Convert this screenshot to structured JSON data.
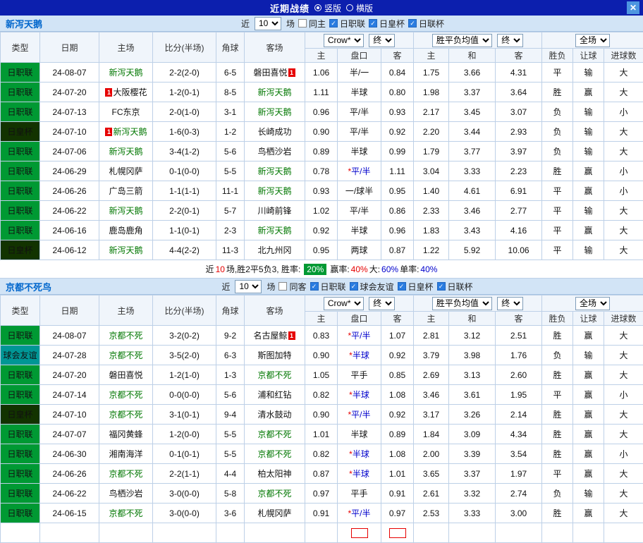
{
  "colors": {
    "titlebar_bg": "#0c1fae",
    "league_green": "#009933",
    "emperor_cup_dark": "#123300",
    "friendly_teal": "#009695",
    "focus_team_green": "#007700",
    "score_red": "#e60000",
    "odds_blue": "#0000cc",
    "win_red": "#e60000",
    "lose_green": "#008800",
    "draw_blue": "#0000cc",
    "rate_badge_green": "#009933"
  },
  "titlebar": {
    "title": "近期战绩",
    "vertical_label": "竖版",
    "horizontal_label": "横版",
    "close_label": "✕"
  },
  "table_header": {
    "type": "类型",
    "date": "日期",
    "home": "主场",
    "score": "比分(半场)",
    "corner": "角球",
    "away": "客场",
    "odds_source": "Crow*",
    "final_a": "终",
    "h_home": "主",
    "h_handicap": "盘口",
    "h_away": "客",
    "avg_label": "胜平负均值",
    "final_b": "终",
    "a_home": "主",
    "a_draw": "和",
    "a_away": "客",
    "wdl": "胜负",
    "handicap_res": "让球",
    "goals": "进球数",
    "scope": "全场"
  },
  "sections": [
    {
      "team": "新泻天鹅",
      "filter": {
        "near": "近",
        "count": "10",
        "games": "场",
        "same": "同主",
        "leagues": [
          "日职联",
          "日皇杯",
          "日联杯"
        ]
      },
      "rows": [
        {
          "league": "日职联",
          "style": "green",
          "date": "24-08-07",
          "home": "新泻天鹅",
          "home_focus": true,
          "score": "2-2(2-0)",
          "corner": "6-5",
          "away": "磐田喜悦",
          "away_badge_post": "1",
          "ch": "1.06",
          "hd": "半/一",
          "ca": "0.84",
          "ah": "1.75",
          "ad": "3.66",
          "aa": "4.31",
          "wdl": "平",
          "hres": "输",
          "goal": "大"
        },
        {
          "league": "日职联",
          "style": "green",
          "date": "24-07-20",
          "home": "大阪樱花",
          "home_badge_pre": "1",
          "score": "1-2(0-1)",
          "corner": "8-5",
          "away": "新泻天鹅",
          "away_focus": true,
          "ch": "1.11",
          "hd": "半球",
          "ca": "0.80",
          "ah": "1.98",
          "ad": "3.37",
          "aa": "3.64",
          "wdl": "胜",
          "hres": "赢",
          "goal": "大"
        },
        {
          "league": "日职联",
          "style": "green",
          "date": "24-07-13",
          "home": "FC东京",
          "score": "2-0(1-0)",
          "corner": "3-1",
          "away": "新泻天鹅",
          "away_focus": true,
          "ch": "0.96",
          "hd": "平/半",
          "ca": "0.93",
          "ah": "2.17",
          "ad": "3.45",
          "aa": "3.07",
          "wdl": "负",
          "hres": "输",
          "goal": "小"
        },
        {
          "league": "日皇杯",
          "style": "dark",
          "date": "24-07-10",
          "home": "新泻天鹅",
          "home_focus": true,
          "home_badge_pre": "1",
          "score": "1-6(0-3)",
          "corner": "1-2",
          "away": "长崎成功",
          "ch": "0.90",
          "hd": "平/半",
          "ca": "0.92",
          "ah": "2.20",
          "ad": "3.44",
          "aa": "2.93",
          "wdl": "负",
          "hres": "输",
          "goal": "大"
        },
        {
          "league": "日职联",
          "style": "green",
          "date": "24-07-06",
          "home": "新泻天鹅",
          "home_focus": true,
          "score": "3-4(1-2)",
          "corner": "5-6",
          "away": "鸟栖沙岩",
          "ch": "0.89",
          "hd": "半球",
          "ca": "0.99",
          "ah": "1.79",
          "ad": "3.77",
          "aa": "3.97",
          "wdl": "负",
          "hres": "输",
          "goal": "大"
        },
        {
          "league": "日职联",
          "style": "green",
          "date": "24-06-29",
          "home": "札幌冈萨",
          "score": "0-1(0-0)",
          "corner": "5-5",
          "away": "新泻天鹅",
          "away_focus": true,
          "ch": "0.78",
          "hd": "*平/半",
          "ca": "1.11",
          "ah": "3.04",
          "ad": "3.33",
          "aa": "2.23",
          "wdl": "胜",
          "hres": "赢",
          "goal": "小"
        },
        {
          "league": "日职联",
          "style": "green",
          "date": "24-06-26",
          "home": "广岛三箭",
          "score": "1-1(1-1)",
          "corner": "11-1",
          "away": "新泻天鹅",
          "away_focus": true,
          "ch": "0.93",
          "hd": "一/球半",
          "ca": "0.95",
          "ah": "1.40",
          "ad": "4.61",
          "aa": "6.91",
          "wdl": "平",
          "hres": "赢",
          "goal": "小"
        },
        {
          "league": "日职联",
          "style": "green",
          "date": "24-06-22",
          "home": "新泻天鹅",
          "home_focus": true,
          "score": "2-2(0-1)",
          "corner": "5-7",
          "away": "川崎前锋",
          "ch": "1.02",
          "hd": "平/半",
          "ca": "0.86",
          "ah": "2.33",
          "ad": "3.46",
          "aa": "2.77",
          "wdl": "平",
          "hres": "输",
          "goal": "大"
        },
        {
          "league": "日职联",
          "style": "green",
          "date": "24-06-16",
          "home": "鹿岛鹿角",
          "score": "1-1(0-1)",
          "corner": "2-3",
          "away": "新泻天鹅",
          "away_focus": true,
          "ch": "0.92",
          "hd": "半球",
          "ca": "0.96",
          "ah": "1.83",
          "ad": "3.43",
          "aa": "4.16",
          "wdl": "平",
          "hres": "赢",
          "goal": "大"
        },
        {
          "league": "日皇杯",
          "style": "dark",
          "date": "24-06-12",
          "home": "新泻天鹅",
          "home_focus": true,
          "score": "4-4(2-2)",
          "corner": "11-3",
          "away": "北九州冈",
          "ch": "0.95",
          "hd": "两球",
          "ca": "0.87",
          "ah": "1.22",
          "ad": "5.92",
          "aa": "10.06",
          "wdl": "平",
          "hres": "输",
          "goal": "大"
        }
      ],
      "summary": [
        {
          "t": "近",
          "c": "k"
        },
        {
          "t": "10",
          "c": "r"
        },
        {
          "t": "场,胜2平5负3, 胜率: ",
          "c": "k"
        },
        {
          "t": "20%",
          "c": "badge"
        },
        {
          "t": " 赢率:",
          "c": "k"
        },
        {
          "t": "40%",
          "c": "r"
        },
        {
          "t": " 大:",
          "c": "k"
        },
        {
          "t": "60%",
          "c": "b"
        },
        {
          "t": " 单率:",
          "c": "k"
        },
        {
          "t": "40%",
          "c": "b"
        }
      ]
    },
    {
      "team": "京都不死鸟",
      "filter": {
        "near": "近",
        "count": "10",
        "games": "场",
        "same": "同客",
        "leagues": [
          "日职联",
          "球会友谊",
          "日皇杯",
          "日联杯"
        ]
      },
      "rows": [
        {
          "league": "日职联",
          "style": "green",
          "date": "24-08-07",
          "home": "京都不死",
          "home_focus": true,
          "score": "3-2(0-2)",
          "corner": "9-2",
          "away": "名古屋鲸",
          "away_badge_post": "1",
          "ch": "0.83",
          "hd": "*平/半",
          "ca": "1.07",
          "ah": "2.81",
          "ad": "3.12",
          "aa": "2.51",
          "wdl": "胜",
          "hres": "赢",
          "goal": "大"
        },
        {
          "league": "球会友谊",
          "style": "teal",
          "date": "24-07-28",
          "home": "京都不死",
          "home_focus": true,
          "score": "3-5(2-0)",
          "corner": "6-3",
          "away": "斯图加特",
          "ch": "0.90",
          "hd": "*半球",
          "ca": "0.92",
          "ah": "3.79",
          "ad": "3.98",
          "aa": "1.76",
          "wdl": "负",
          "hres": "输",
          "goal": "大"
        },
        {
          "league": "日职联",
          "style": "green",
          "date": "24-07-20",
          "home": "磐田喜悦",
          "score": "1-2(1-0)",
          "corner": "1-3",
          "away": "京都不死",
          "away_focus": true,
          "ch": "1.05",
          "hd": "平手",
          "ca": "0.85",
          "ah": "2.69",
          "ad": "3.13",
          "aa": "2.60",
          "wdl": "胜",
          "hres": "赢",
          "goal": "大"
        },
        {
          "league": "日职联",
          "style": "green",
          "date": "24-07-14",
          "home": "京都不死",
          "home_focus": true,
          "score": "0-0(0-0)",
          "corner": "5-6",
          "away": "浦和红钻",
          "ch": "0.82",
          "hd": "*半球",
          "ca": "1.08",
          "ah": "3.46",
          "ad": "3.61",
          "aa": "1.95",
          "wdl": "平",
          "hres": "赢",
          "goal": "小"
        },
        {
          "league": "日皇杯",
          "style": "dark",
          "date": "24-07-10",
          "home": "京都不死",
          "home_focus": true,
          "score": "3-1(0-1)",
          "corner": "9-4",
          "away": "清水鼓动",
          "ch": "0.90",
          "hd": "*平/半",
          "ca": "0.92",
          "ah": "3.17",
          "ad": "3.26",
          "aa": "2.14",
          "wdl": "胜",
          "hres": "赢",
          "goal": "大"
        },
        {
          "league": "日职联",
          "style": "green",
          "date": "24-07-07",
          "home": "福冈黄蜂",
          "score": "1-2(0-0)",
          "corner": "5-5",
          "away": "京都不死",
          "away_focus": true,
          "ch": "1.01",
          "hd": "半球",
          "ca": "0.89",
          "ah": "1.84",
          "ad": "3.09",
          "aa": "4.34",
          "wdl": "胜",
          "hres": "赢",
          "goal": "大"
        },
        {
          "league": "日职联",
          "style": "green",
          "date": "24-06-30",
          "home": "湘南海洋",
          "score": "0-1(0-1)",
          "corner": "5-5",
          "away": "京都不死",
          "away_focus": true,
          "ch": "0.82",
          "hd": "*半球",
          "ca": "1.08",
          "ah": "2.00",
          "ad": "3.39",
          "aa": "3.54",
          "wdl": "胜",
          "hres": "赢",
          "goal": "小"
        },
        {
          "league": "日职联",
          "style": "green",
          "date": "24-06-26",
          "home": "京都不死",
          "home_focus": true,
          "score": "2-2(1-1)",
          "corner": "4-4",
          "away": "柏太阳神",
          "ch": "0.87",
          "hd": "*半球",
          "ca": "1.01",
          "ah": "3.65",
          "ad": "3.37",
          "aa": "1.97",
          "wdl": "平",
          "hres": "赢",
          "goal": "大"
        },
        {
          "league": "日职联",
          "style": "green",
          "date": "24-06-22",
          "home": "鸟栖沙岩",
          "score": "3-0(0-0)",
          "corner": "5-8",
          "away": "京都不死",
          "away_focus": true,
          "ch": "0.97",
          "hd": "平手",
          "ca": "0.91",
          "ah": "2.61",
          "ad": "3.32",
          "aa": "2.74",
          "wdl": "负",
          "hres": "输",
          "goal": "大"
        },
        {
          "league": "日职联",
          "style": "green",
          "date": "24-06-15",
          "home": "京都不死",
          "home_focus": true,
          "score": "3-0(0-0)",
          "corner": "3-6",
          "away": "札幌冈萨",
          "ch": "0.91",
          "hd": "*平/半",
          "ca": "0.97",
          "ah": "2.53",
          "ad": "3.33",
          "aa": "3.00",
          "wdl": "胜",
          "hres": "赢",
          "goal": "大"
        }
      ],
      "summary": [],
      "partial_row": true
    }
  ]
}
